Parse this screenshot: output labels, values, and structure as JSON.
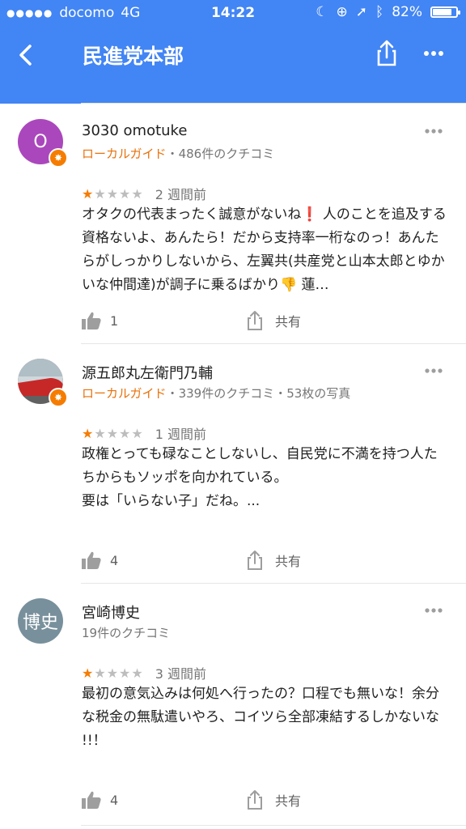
{
  "status_bar": {
    "carrier": "docomo",
    "network": "4G",
    "time": "14:22",
    "battery": "82%",
    "battery_level": 0.82
  },
  "header": {
    "title": "民進党本部",
    "back_icon": "chevron-left-icon",
    "share_icon": "share-icon",
    "more_icon": "more-horiz-icon"
  },
  "reviews": [
    {
      "name": "3030 omotuke",
      "avatar_text": "O",
      "avatar_color": "#ab47bc",
      "local_guide": "ローカルガイド",
      "stats": "・486件のクチコミ",
      "rating": 1,
      "time": "2 週間前",
      "text": "オタクの代表まったく誠意がないね❗️ 人のことを追及する資格ないよ、あんたら！だから支持率一桁なのっ！あんたらがしっかりしないから、左翼共(共産党と山本太郎とゆかいな仲間達)が調子に乗るばかり👎 蓮…",
      "likes": "1",
      "share_label": "共有"
    },
    {
      "name": "源五郎丸左衛門乃輔",
      "avatar_text": "",
      "avatar_color": "#8d6e63",
      "local_guide": "ローカルガイド",
      "stats": "・339件のクチコミ・53枚の写真",
      "rating": 1,
      "time": "1 週間前",
      "text": "政権とっても碌なことしないし、自民党に不満を持つ人たちからもソッポを向かれている。\n要は「いらない子」だね。...",
      "likes": "4",
      "share_label": "共有"
    },
    {
      "name": "宮崎博史",
      "avatar_text": "博史",
      "avatar_color": "#78909c",
      "local_guide": "",
      "stats": "19件のクチコミ",
      "rating": 1,
      "time": "3 週間前",
      "text": "最初の意気込みは何処へ行ったの？口程でも無いな！余分な税金の無駄遣いやろ、コイツら全部凍結するしかないな\n!!！",
      "likes": "4",
      "share_label": "共有"
    }
  ]
}
